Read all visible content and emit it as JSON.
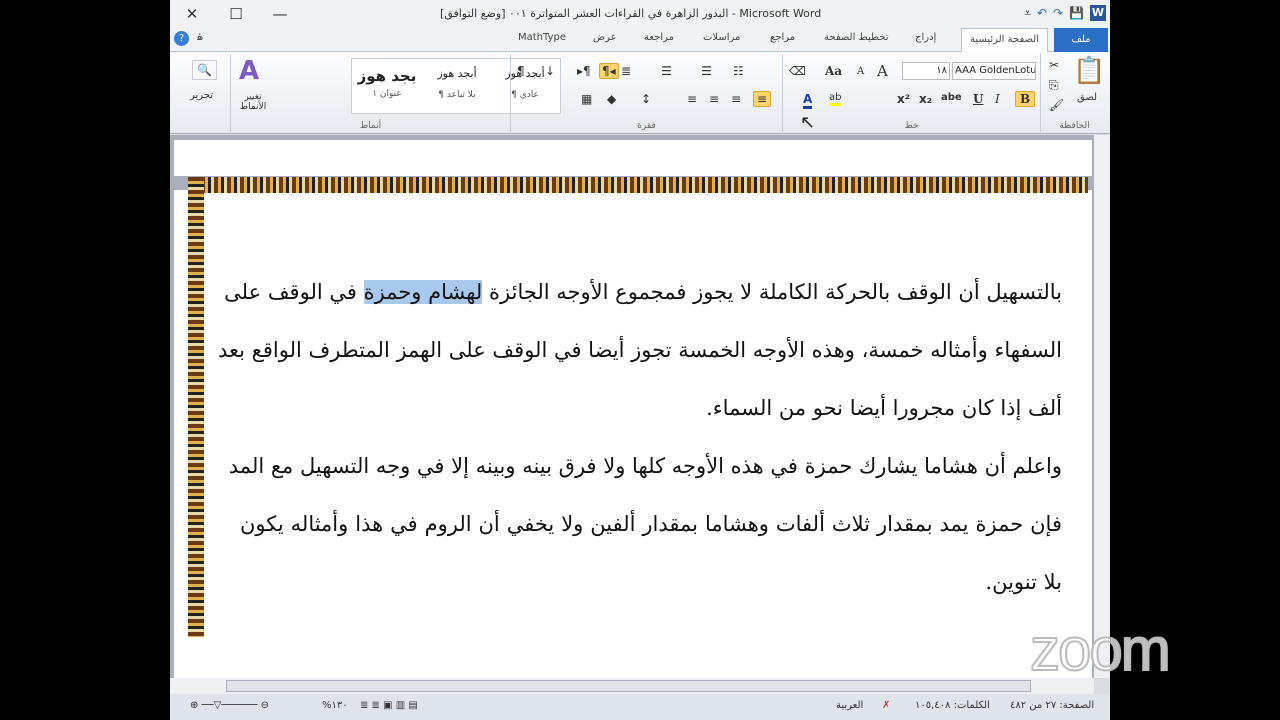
{
  "window": {
    "title": "البدور الزاهرة في القراءات العشر المتواترة ٠٠١ [وضع التوافق] - Microsoft Word",
    "close": "✕",
    "maximize": "☐",
    "minimize": "—"
  },
  "qat": {
    "word": "W",
    "save": "💾",
    "redo": "↷",
    "undo": "↶",
    "customize": "⩡"
  },
  "tabs": {
    "file": "ملف",
    "home": "الصفحة الرئيسية",
    "insert": "إدراج",
    "layout": "تخطيط الصفحة",
    "references": "مراجع",
    "mailings": "مراسلات",
    "review": "مراجعة",
    "view": "عرض",
    "mathtype": "MathType",
    "help": "?",
    "minimize": "ۿ"
  },
  "ribbon": {
    "clipboard": {
      "label": "الحافظة",
      "paste": "لصق"
    },
    "font": {
      "label": "خط",
      "name": "AAA GoldenLotus",
      "size": "١٨",
      "bold": "B",
      "italic": "I",
      "underline": "U",
      "strike": "abe",
      "sub": "x₂",
      "sup": "x²",
      "color": "A",
      "highlight": "ab",
      "grow": "A",
      "shrink": "A",
      "case": "Aa"
    },
    "paragraph": {
      "label": "فقرة"
    },
    "styles": {
      "label": "أنماط",
      "items": [
        {
          "sample": "أبجد هوز",
          "name": "¶ عادي"
        },
        {
          "sample": "أبجد هوز",
          "name": "¶ بلا تباعد"
        },
        {
          "sample": "بجد هوز",
          "name": "عنوان ١"
        }
      ],
      "change": "تغيير الأنماط"
    },
    "editing": {
      "label": "تحرير"
    }
  },
  "document": {
    "lines": [
      {
        "before": "بالتسهيل أن الوقف بالحركة الكاملة لا يجوز فمجموع الأوجه الجائزة ",
        "selected": "لهشام وحمزة",
        "after": " في الوقف على"
      },
      "السفهاء وأمثاله خمسة، وهذه الأوجه الخمسة تجوز أيضا في الوقف على الهمز المتطرف الواقع بعد",
      "ألف إذا كان مجرورا أيضا نحو من السماء.",
      "واعلم أن هشاما يشارك حمزة في هذه الأوجه كلها ولا فرق بينه وبينه إلا في وجه التسهيل مع المد",
      "فإن حمزة يمد بمقدار ثلاث ألفات وهشاما بمقدار ألفين ولا يخفي أن الروم في هذا وأمثاله يكون",
      "بلا تنوين."
    ]
  },
  "status": {
    "page": "الصفحة: ٢٧ من ٤٨٢",
    "words": "الكلمات: ١٠٥,٤٠٨",
    "language": "العربية",
    "zoom": "%١٣٠"
  },
  "watermark": "zoom"
}
